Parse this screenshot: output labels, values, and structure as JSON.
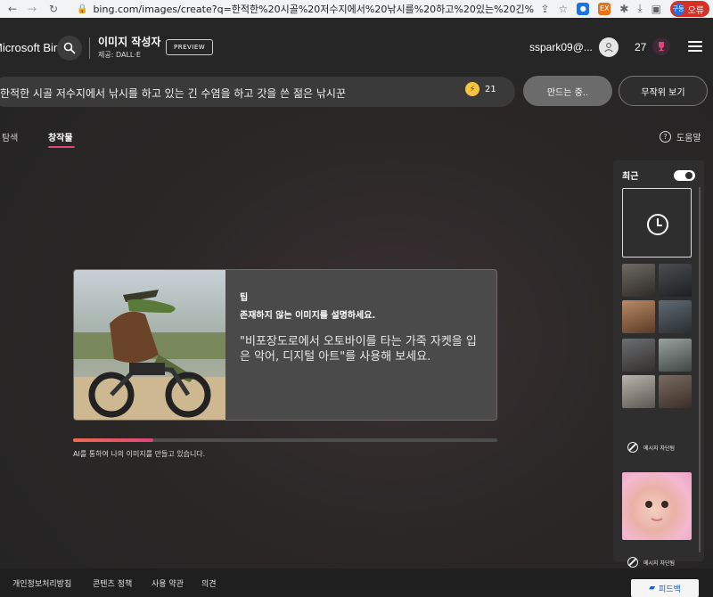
{
  "browser": {
    "url": "bing.com/images/create?q=한적한%20시골%20저수지에서%20낚시를%20하고%20있는%20긴%20수염...",
    "profile_label": "오류",
    "profile_avatar": "구등"
  },
  "header": {
    "brand": "Microsoft Bing",
    "app_title": "이미지 작성자",
    "app_subtitle": "제공: DALL·E",
    "preview_badge": "PREVIEW",
    "user_name": "sspark09@...",
    "reward_count": "27"
  },
  "prompt": {
    "text": "한적한 시골 저수지에서 낚시를 하고 있는 긴 수염을 하고 갓을 쓴 젊은 낚시꾼",
    "boost_count": "21",
    "create_button": "만드는 중..",
    "surprise_button": "무작위 보기"
  },
  "tabs": {
    "explore": "아이디어 탐색",
    "creations": "창작물",
    "help": "도움말"
  },
  "tip": {
    "label": "팁",
    "heading": "존재하지 않는 이미지를 설명하세요.",
    "body": "\"비포장도로에서 오토바이를 타는 가죽 자켓을 입은 악어, 디지털 아트\"를 사용해 보세요."
  },
  "progress": {
    "value": 0.19,
    "caption": "AI를 통하여 나의 이미지를 만들고 있습니다."
  },
  "recent": {
    "title": "최근",
    "toggle_on": true,
    "blocked_label_1": "메시지 차단됨",
    "blocked_label_2": "메시지 차단됨"
  },
  "footer": {
    "links": [
      "개인정보처리방침",
      "콘텐츠 정책",
      "사용 약관",
      "의견"
    ],
    "feedback": "피드백"
  },
  "colors": {
    "accent_pink": "#e0447a",
    "accent_orange": "#f06b4f",
    "boost_coin": "#f5c542"
  }
}
